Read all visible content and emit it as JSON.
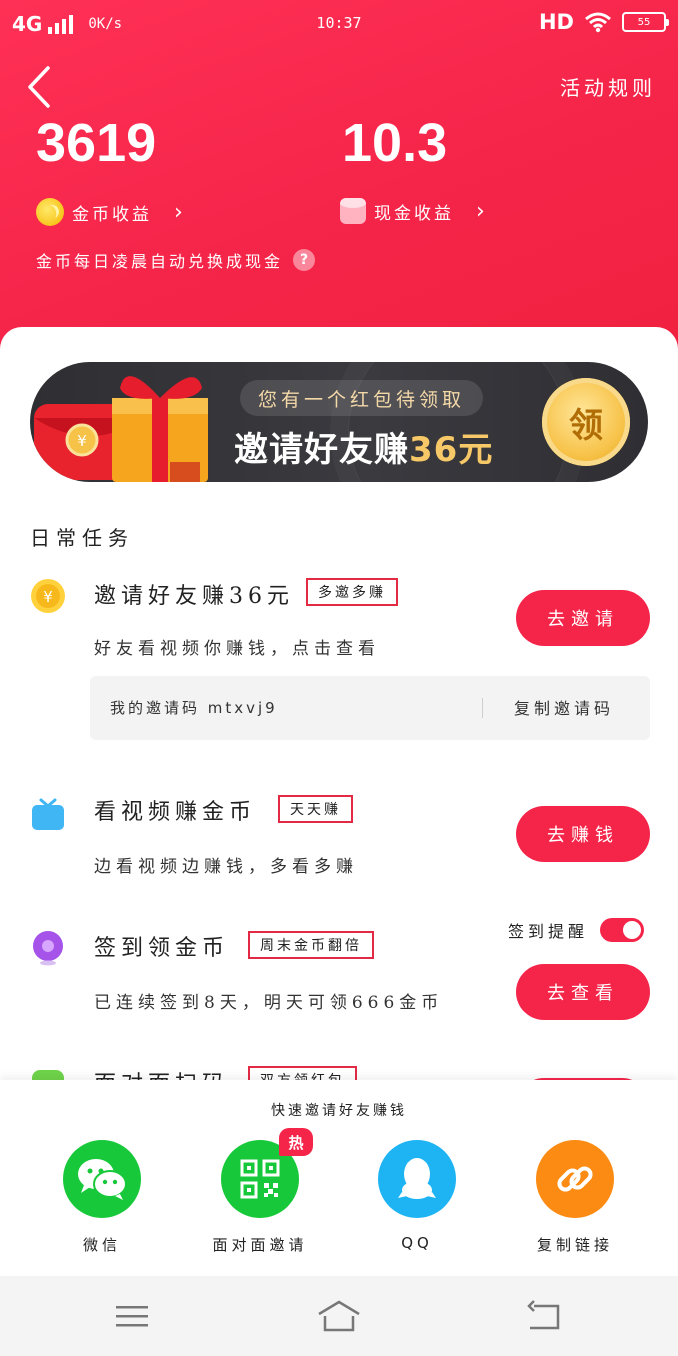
{
  "status_bar": {
    "network": "4G",
    "speed": "0K/s",
    "time": "10:37",
    "hd": "HD",
    "battery": "55"
  },
  "header": {
    "rules_label": "活动规则",
    "coin_balance": "3619",
    "cash_balance": "10.3",
    "coin_label": "金币收益",
    "cash_label": "现金收益",
    "chevron": "›",
    "note": "金币每日凌晨自动兑换成现金",
    "help": "?"
  },
  "banner": {
    "pill": "您有一个红包待领取",
    "title_prefix": "邀请好友赚",
    "title_amount": "36元",
    "coin_text": "领",
    "gift_coin": "¥"
  },
  "section_title": "日常任务",
  "tasks": [
    {
      "title": "邀请好友赚36元",
      "tag": "多邀多赚",
      "desc": "好友看视频你赚钱，点击查看",
      "button": "去邀请"
    },
    {
      "title": "看视频赚金币",
      "tag": "天天赚",
      "desc": "边看视频边赚钱，多看多赚",
      "button": "去赚钱"
    },
    {
      "title": "签到领金币",
      "tag": "周末金币翻倍",
      "desc": "已连续签到8天，明天可领666金币",
      "button": "去查看"
    },
    {
      "title": "面对面扫码",
      "tag": "双方领红包"
    }
  ],
  "invite": {
    "code_label": "我的邀请码 mtxvj9",
    "copy_label": "复制邀请码"
  },
  "remind_label": "签到提醒",
  "share": {
    "title": "快速邀请好友赚钱",
    "items": [
      {
        "label": "微信",
        "color": "#17c93a"
      },
      {
        "label": "面对面邀请",
        "color": "#17c93a",
        "badge": "热"
      },
      {
        "label": "QQ",
        "color": "#1eb4f4"
      },
      {
        "label": "复制链接",
        "color": "#fb8b12"
      }
    ]
  },
  "colors": {
    "primary": "#f5254a",
    "banner_dark": "#333338",
    "gold": "#f7c867"
  }
}
